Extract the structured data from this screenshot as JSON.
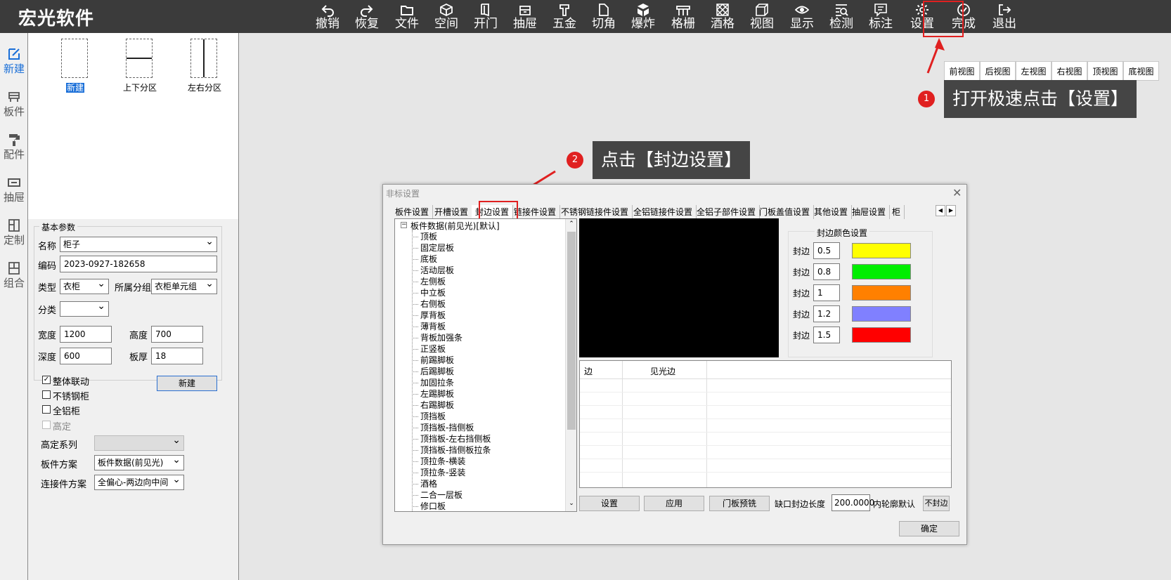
{
  "app": {
    "title": "宏光软件"
  },
  "toolbar": [
    {
      "id": "undo",
      "label": "撤销",
      "icon": "undo-icon"
    },
    {
      "id": "redo",
      "label": "恢复",
      "icon": "redo-icon"
    },
    {
      "id": "file",
      "label": "文件",
      "icon": "folder-icon"
    },
    {
      "id": "space",
      "label": "空间",
      "icon": "cube-icon"
    },
    {
      "id": "door",
      "label": "开门",
      "icon": "door-icon"
    },
    {
      "id": "drawer",
      "label": "抽屉",
      "icon": "drawer-icon"
    },
    {
      "id": "hardware",
      "label": "五金",
      "icon": "hammer-icon"
    },
    {
      "id": "cut",
      "label": "切角",
      "icon": "cut-corner-icon"
    },
    {
      "id": "explode",
      "label": "爆炸",
      "icon": "explode-icon"
    },
    {
      "id": "grille",
      "label": "格栅",
      "icon": "grille-icon"
    },
    {
      "id": "wine",
      "label": "酒格",
      "icon": "wine-rack-icon"
    },
    {
      "id": "view",
      "label": "视图",
      "icon": "view-cube-icon"
    },
    {
      "id": "display",
      "label": "显示",
      "icon": "eye-icon"
    },
    {
      "id": "check",
      "label": "检测",
      "icon": "inspect-icon"
    },
    {
      "id": "annotate",
      "label": "标注",
      "icon": "comment-icon"
    },
    {
      "id": "settings",
      "label": "设置",
      "icon": "gear-icon"
    },
    {
      "id": "done",
      "label": "完成",
      "icon": "check-circle-icon"
    },
    {
      "id": "exit",
      "label": "退出",
      "icon": "exit-icon"
    }
  ],
  "leftnav": [
    {
      "label": "新建",
      "icon": "edit-icon"
    },
    {
      "label": "板件",
      "icon": "board-icon"
    },
    {
      "label": "配件",
      "icon": "paint-roller-icon"
    },
    {
      "label": "抽屉",
      "icon": "drawer-icon"
    },
    {
      "label": "定制",
      "icon": "custom-icon"
    },
    {
      "label": "组合",
      "icon": "combine-icon"
    }
  ],
  "templates": [
    {
      "label": "新建"
    },
    {
      "label": "上下分区"
    },
    {
      "label": "左右分区"
    }
  ],
  "params": {
    "group_title": "基本参数",
    "name_label": "名称",
    "name_value": "柜子",
    "code_label": "编码",
    "code_value": "2023-0927-182658",
    "type_label": "类型",
    "type_value": "衣柜",
    "group_label": "所属分组",
    "group_value": "衣柜单元组",
    "category_label": "分类",
    "category_value": "",
    "width_label": "宽度",
    "width_value": "1200",
    "height_label": "高度",
    "height_value": "700",
    "depth_label": "深度",
    "depth_value": "600",
    "thickness_label": "板厚",
    "thickness_value": "18"
  },
  "options": {
    "linkage": "整体联动",
    "new_button": "新建",
    "stainless": "不锈钢柜",
    "aluminum": "全铝柜",
    "custom_height": "高定",
    "series_label": "高定系列",
    "series_value": "",
    "board_plan_label": "板件方案",
    "board_plan_value": "板件数据(前见光)",
    "connector_plan_label": "连接件方案",
    "connector_plan_value": "全偏心-两边向中间"
  },
  "viewtabs": [
    "前视图",
    "后视图",
    "左视图",
    "右视图",
    "顶视图",
    "底视图"
  ],
  "callouts": [
    {
      "number": "1",
      "text": "打开极速点击【设置】"
    },
    {
      "number": "2",
      "text": "点击【封边设置】"
    }
  ],
  "dialog": {
    "title": "非标设置",
    "tabs": [
      "板件设置",
      "开槽设置",
      "封边设置",
      "链接件设置",
      "不锈钢链接件设置",
      "全铝链接件设置",
      "全铝子部件设置",
      "门板盖值设置",
      "其他设置",
      "抽屉设置",
      "柜"
    ],
    "tree_root": "板件数据(前见光)[默认]",
    "tree_items": [
      "顶板",
      "固定层板",
      "底板",
      "活动层板",
      "左侧板",
      "中立板",
      "右侧板",
      "厚背板",
      "薄背板",
      "背板加强条",
      "正竖板",
      "前踢脚板",
      "后踢脚板",
      "加固拉条",
      "左踢脚板",
      "右踢脚板",
      "顶挡板",
      "顶挡板-挡侧板",
      "顶挡板-左右挡侧板",
      "顶挡板-挡侧板拉条",
      "顶拉条-横装",
      "顶拉条-竖装",
      "酒格",
      "二合一层板",
      "修口板"
    ],
    "color_group_title": "封边颜色设置",
    "edge_rows": [
      {
        "label": "封边",
        "value": "0.5",
        "color": "#ffff00"
      },
      {
        "label": "封边",
        "value": "0.8",
        "color": "#00ee00"
      },
      {
        "label": "封边",
        "value": "1",
        "color": "#ff8000"
      },
      {
        "label": "封边",
        "value": "1.2",
        "color": "#8080ff"
      },
      {
        "label": "封边",
        "value": "1.5",
        "color": "#ff0000"
      }
    ],
    "table_headers": [
      "边",
      "见光边"
    ],
    "buttons": {
      "set": "设置",
      "apply": "应用",
      "door_mill": "门板预铣",
      "gap_label": "缺口封边长度",
      "gap_value": "200.0000",
      "inner_label": "内轮廓默认",
      "inner_value": "不封边",
      "ok": "确定"
    }
  }
}
